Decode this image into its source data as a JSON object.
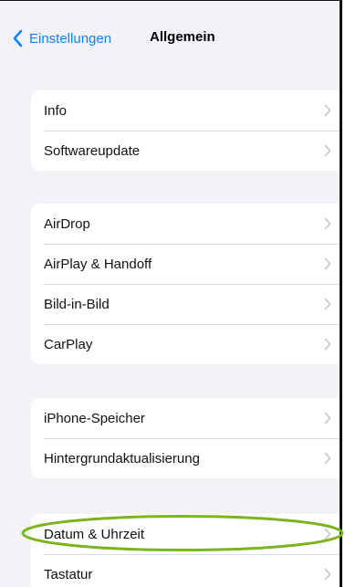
{
  "navigation": {
    "back_label": "Einstellungen",
    "title": "Allgemein"
  },
  "groups": [
    {
      "rows": [
        {
          "label": "Info"
        },
        {
          "label": "Softwareupdate"
        }
      ]
    },
    {
      "rows": [
        {
          "label": "AirDrop"
        },
        {
          "label": "AirPlay & Handoff"
        },
        {
          "label": "Bild-in-Bild"
        },
        {
          "label": "CarPlay"
        }
      ]
    },
    {
      "rows": [
        {
          "label": "iPhone-Speicher"
        },
        {
          "label": "Hintergrundaktualisierung"
        }
      ]
    },
    {
      "rows": [
        {
          "label": "Datum & Uhrzeit"
        },
        {
          "label": "Tastatur"
        }
      ]
    }
  ],
  "colors": {
    "accent": "#0a84ff",
    "background": "#f2f2f7",
    "highlight": "#7ab51d"
  },
  "icons": {
    "back": "chevron-left-icon",
    "disclosure": "chevron-right-icon"
  }
}
